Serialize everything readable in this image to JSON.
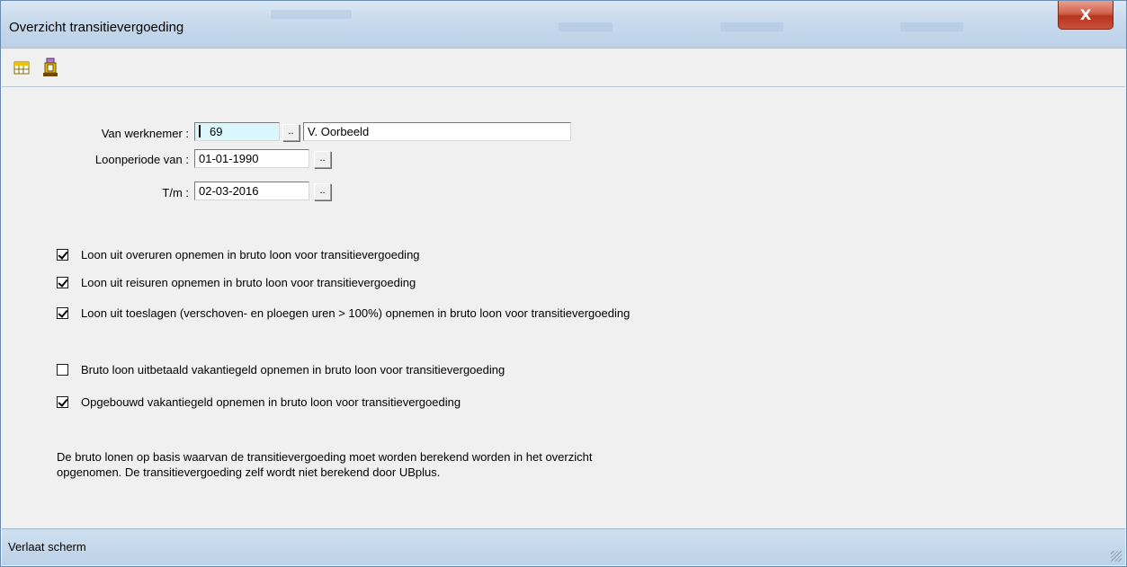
{
  "window": {
    "title": "Overzicht transitievergoeding",
    "close_label": "X"
  },
  "toolbar": {
    "icons": [
      "table-icon",
      "print-icon"
    ]
  },
  "form": {
    "employee_label": "Van werknemer :",
    "employee_number": "69",
    "employee_name": "V. Oorbeeld",
    "period_from_label": "Loonperiode van :",
    "period_from": "01-01-1990",
    "period_to_label": "T/m :",
    "period_to": "02-03-2016",
    "lookup_label": ".."
  },
  "options": [
    {
      "label": "Loon uit overuren opnemen in bruto loon voor transitievergoeding",
      "checked": true
    },
    {
      "label": "Loon uit reisuren opnemen in bruto loon voor transitievergoeding",
      "checked": true
    },
    {
      "label": "Loon uit toeslagen (verschoven- en ploegen uren > 100%) opnemen in bruto loon voor transitievergoeding",
      "checked": true
    },
    {
      "label": "Bruto loon uitbetaald vakantiegeld opnemen in bruto loon voor transitievergoeding",
      "checked": false
    },
    {
      "label": "Opgebouwd vakantiegeld opnemen in bruto loon voor transitievergoeding",
      "checked": true
    }
  ],
  "info": {
    "line1": "De bruto lonen op basis waarvan de transitievergoeding moet worden berekend worden in het overzicht",
    "line2": "opgenomen. De transitievergoeding zelf wordt niet berekend door UBplus."
  },
  "statusbar": {
    "text": "Verlaat scherm"
  }
}
